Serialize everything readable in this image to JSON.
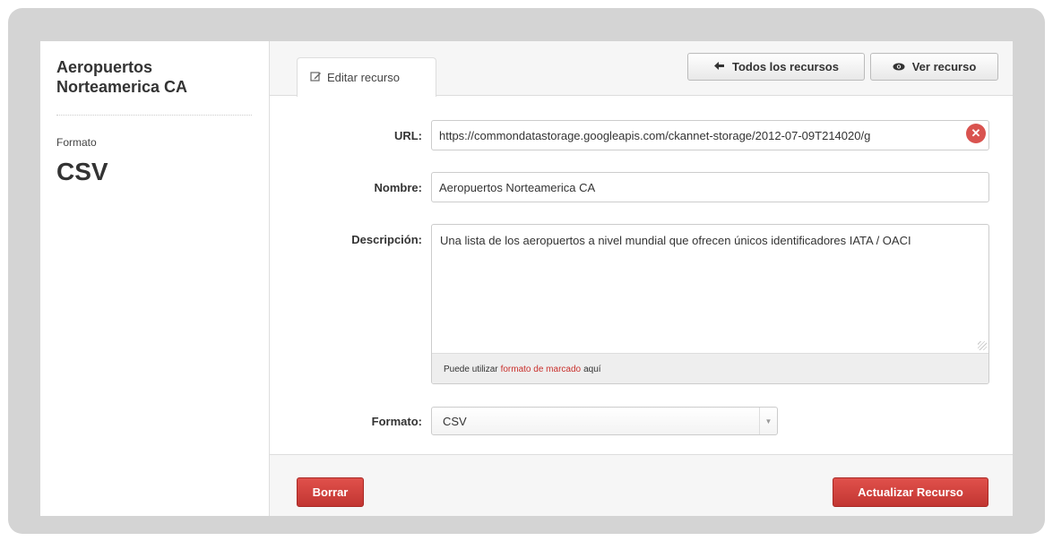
{
  "sidebar": {
    "dataset_title": "Aeropuertos Norteamerica CA",
    "format_label": "Formato",
    "format_value": "CSV"
  },
  "tabs": [
    {
      "label": "Editar recurso",
      "icon": "edit-icon"
    }
  ],
  "header_buttons": {
    "all_resources": {
      "label": "Todos los recursos",
      "icon": "arrow-left-icon"
    },
    "view_resource": {
      "label": "Ver recurso",
      "icon": "eye-icon"
    }
  },
  "form": {
    "url": {
      "label": "URL:",
      "value": "https://commondatastorage.googleapis.com/ckannet-storage/2012-07-09T214020/g"
    },
    "name": {
      "label": "Nombre:",
      "value": "Aeropuertos Norteamerica CA"
    },
    "description": {
      "label": "Descripción:",
      "value": "Una lista de los aeropuertos a nivel mundial que ofrecen únicos identificadores IATA / OACI",
      "markdown_note_prefix": "Puede utilizar",
      "markdown_link": "formato de marcado",
      "markdown_note_suffix": "aquí"
    },
    "format": {
      "label": "Formato:",
      "value": "CSV"
    }
  },
  "actions": {
    "delete_label": "Borrar",
    "update_label": "Actualizar Recurso"
  },
  "colors": {
    "danger": "#c9302c",
    "frame": "#d4d4d4"
  }
}
